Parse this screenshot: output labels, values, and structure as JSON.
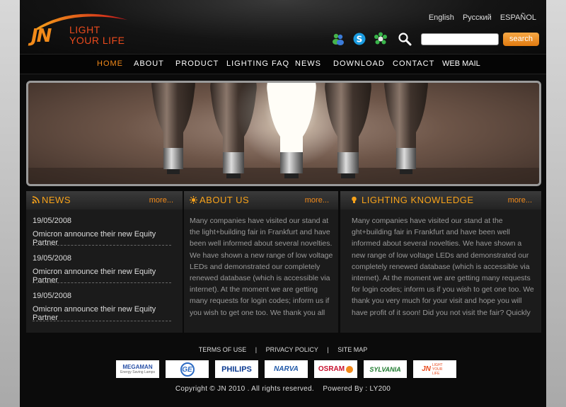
{
  "logo": {
    "mark": "JN",
    "line1": "LIGHT",
    "line2": "YOUR LIFE"
  },
  "languages": [
    "English",
    "Русский",
    "ESPAÑOL"
  ],
  "header_icons": [
    "msn-icon",
    "skype-icon",
    "icq-icon",
    "search-icon"
  ],
  "search": {
    "value": "",
    "button_label": "search"
  },
  "nav": [
    "HOME",
    "ABOUT",
    "PRODUCT",
    "LIGHTING FAQ",
    "NEWS",
    "DOWNLOAD",
    "CONTACT",
    "WEB MAIL"
  ],
  "colors": {
    "accent": "#f28a1a",
    "title": "#f7a21a",
    "background": "#0b0b0b"
  },
  "news": {
    "title": "NEWS",
    "more": "more...",
    "items": [
      {
        "date": "19/05/2008",
        "text": "Omicron announce their new Equity Partner"
      },
      {
        "date": "19/05/2008",
        "text": "Omicron announce their new Equity Partner"
      },
      {
        "date": "19/05/2008",
        "text": "Omicron announce their new Equity Partner"
      }
    ]
  },
  "about": {
    "title": "ABOUT US",
    "more": "more...",
    "text": "Many companies have visited our stand at the light+building fair in Frankfurt and have been well informed about several novelties. We have shown a new range of low voltage LEDs and demonstrated our completely renewed database (which is accessible via internet). At the moment we are getting many requests for login codes; inform us if you wish to get one too. We thank you all very much for your visit"
  },
  "knowledge": {
    "title": "LIGHTING KNOWLEDGE",
    "more": "more...",
    "text": "Many companies have visited our stand at the ght+building fair in Frankfurt and have been well informed about several novelties. We have shown a new range of low voltage LEDs and demonstrated our completely renewed database (which is accessible via internet). At the moment we are getting many requests for login codes; inform us if you wish to get one too. We thank you very much for your visit and hope you will have profit of it soon! Did you not visit the fair? Quickly check our Bailey fair"
  },
  "footer": {
    "links": [
      "TERMS OF USE",
      "PRIVACY POLICY",
      "SITE MAP"
    ],
    "separator": "|",
    "brands": [
      {
        "name": "MEGAMAN",
        "sub": "Energy Saving Lamps"
      },
      {
        "name": "GE"
      },
      {
        "name": "PHILIPS"
      },
      {
        "name": "NARVA"
      },
      {
        "name": "OSRAM"
      },
      {
        "name": "SYLVANIA"
      },
      {
        "name": "JN",
        "sub": "LIGHT YOUR LIFE"
      }
    ],
    "copyright": "Copyright © JN 2010 . All rights reserved.",
    "powered": "Powered By : LY200"
  }
}
